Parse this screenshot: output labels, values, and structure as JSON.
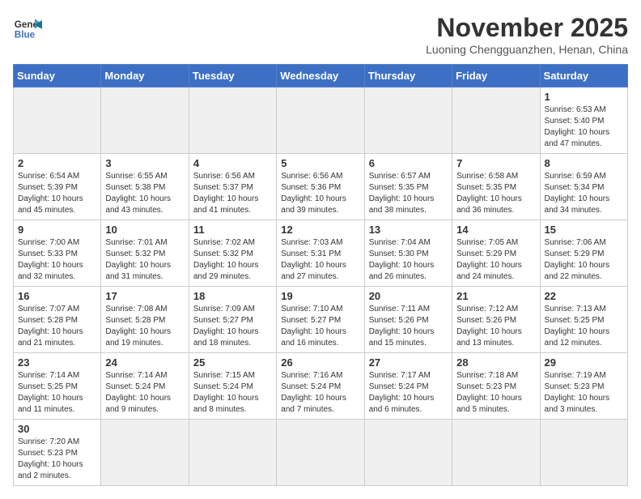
{
  "header": {
    "logo_line1": "General",
    "logo_line2": "Blue",
    "month_title": "November 2025",
    "location": "Luoning Chengguanzhen, Henan, China"
  },
  "weekdays": [
    "Sunday",
    "Monday",
    "Tuesday",
    "Wednesday",
    "Thursday",
    "Friday",
    "Saturday"
  ],
  "weeks": [
    [
      {
        "day": "",
        "info": "",
        "empty": true
      },
      {
        "day": "",
        "info": "",
        "empty": true
      },
      {
        "day": "",
        "info": "",
        "empty": true
      },
      {
        "day": "",
        "info": "",
        "empty": true
      },
      {
        "day": "",
        "info": "",
        "empty": true
      },
      {
        "day": "",
        "info": "",
        "empty": true
      },
      {
        "day": "1",
        "info": "Sunrise: 6:53 AM\nSunset: 5:40 PM\nDaylight: 10 hours\nand 47 minutes."
      }
    ],
    [
      {
        "day": "2",
        "info": "Sunrise: 6:54 AM\nSunset: 5:39 PM\nDaylight: 10 hours\nand 45 minutes."
      },
      {
        "day": "3",
        "info": "Sunrise: 6:55 AM\nSunset: 5:38 PM\nDaylight: 10 hours\nand 43 minutes."
      },
      {
        "day": "4",
        "info": "Sunrise: 6:56 AM\nSunset: 5:37 PM\nDaylight: 10 hours\nand 41 minutes."
      },
      {
        "day": "5",
        "info": "Sunrise: 6:56 AM\nSunset: 5:36 PM\nDaylight: 10 hours\nand 39 minutes."
      },
      {
        "day": "6",
        "info": "Sunrise: 6:57 AM\nSunset: 5:35 PM\nDaylight: 10 hours\nand 38 minutes."
      },
      {
        "day": "7",
        "info": "Sunrise: 6:58 AM\nSunset: 5:35 PM\nDaylight: 10 hours\nand 36 minutes."
      },
      {
        "day": "8",
        "info": "Sunrise: 6:59 AM\nSunset: 5:34 PM\nDaylight: 10 hours\nand 34 minutes."
      }
    ],
    [
      {
        "day": "9",
        "info": "Sunrise: 7:00 AM\nSunset: 5:33 PM\nDaylight: 10 hours\nand 32 minutes."
      },
      {
        "day": "10",
        "info": "Sunrise: 7:01 AM\nSunset: 5:32 PM\nDaylight: 10 hours\nand 31 minutes."
      },
      {
        "day": "11",
        "info": "Sunrise: 7:02 AM\nSunset: 5:32 PM\nDaylight: 10 hours\nand 29 minutes."
      },
      {
        "day": "12",
        "info": "Sunrise: 7:03 AM\nSunset: 5:31 PM\nDaylight: 10 hours\nand 27 minutes."
      },
      {
        "day": "13",
        "info": "Sunrise: 7:04 AM\nSunset: 5:30 PM\nDaylight: 10 hours\nand 26 minutes."
      },
      {
        "day": "14",
        "info": "Sunrise: 7:05 AM\nSunset: 5:29 PM\nDaylight: 10 hours\nand 24 minutes."
      },
      {
        "day": "15",
        "info": "Sunrise: 7:06 AM\nSunset: 5:29 PM\nDaylight: 10 hours\nand 22 minutes."
      }
    ],
    [
      {
        "day": "16",
        "info": "Sunrise: 7:07 AM\nSunset: 5:28 PM\nDaylight: 10 hours\nand 21 minutes."
      },
      {
        "day": "17",
        "info": "Sunrise: 7:08 AM\nSunset: 5:28 PM\nDaylight: 10 hours\nand 19 minutes."
      },
      {
        "day": "18",
        "info": "Sunrise: 7:09 AM\nSunset: 5:27 PM\nDaylight: 10 hours\nand 18 minutes."
      },
      {
        "day": "19",
        "info": "Sunrise: 7:10 AM\nSunset: 5:27 PM\nDaylight: 10 hours\nand 16 minutes."
      },
      {
        "day": "20",
        "info": "Sunrise: 7:11 AM\nSunset: 5:26 PM\nDaylight: 10 hours\nand 15 minutes."
      },
      {
        "day": "21",
        "info": "Sunrise: 7:12 AM\nSunset: 5:26 PM\nDaylight: 10 hours\nand 13 minutes."
      },
      {
        "day": "22",
        "info": "Sunrise: 7:13 AM\nSunset: 5:25 PM\nDaylight: 10 hours\nand 12 minutes."
      }
    ],
    [
      {
        "day": "23",
        "info": "Sunrise: 7:14 AM\nSunset: 5:25 PM\nDaylight: 10 hours\nand 11 minutes."
      },
      {
        "day": "24",
        "info": "Sunrise: 7:14 AM\nSunset: 5:24 PM\nDaylight: 10 hours\nand 9 minutes."
      },
      {
        "day": "25",
        "info": "Sunrise: 7:15 AM\nSunset: 5:24 PM\nDaylight: 10 hours\nand 8 minutes."
      },
      {
        "day": "26",
        "info": "Sunrise: 7:16 AM\nSunset: 5:24 PM\nDaylight: 10 hours\nand 7 minutes."
      },
      {
        "day": "27",
        "info": "Sunrise: 7:17 AM\nSunset: 5:24 PM\nDaylight: 10 hours\nand 6 minutes."
      },
      {
        "day": "28",
        "info": "Sunrise: 7:18 AM\nSunset: 5:23 PM\nDaylight: 10 hours\nand 5 minutes."
      },
      {
        "day": "29",
        "info": "Sunrise: 7:19 AM\nSunset: 5:23 PM\nDaylight: 10 hours\nand 3 minutes."
      }
    ],
    [
      {
        "day": "30",
        "info": "Sunrise: 7:20 AM\nSunset: 5:23 PM\nDaylight: 10 hours\nand 2 minutes."
      },
      {
        "day": "",
        "info": "",
        "empty": true
      },
      {
        "day": "",
        "info": "",
        "empty": true
      },
      {
        "day": "",
        "info": "",
        "empty": true
      },
      {
        "day": "",
        "info": "",
        "empty": true
      },
      {
        "day": "",
        "info": "",
        "empty": true
      },
      {
        "day": "",
        "info": "",
        "empty": true
      }
    ]
  ]
}
